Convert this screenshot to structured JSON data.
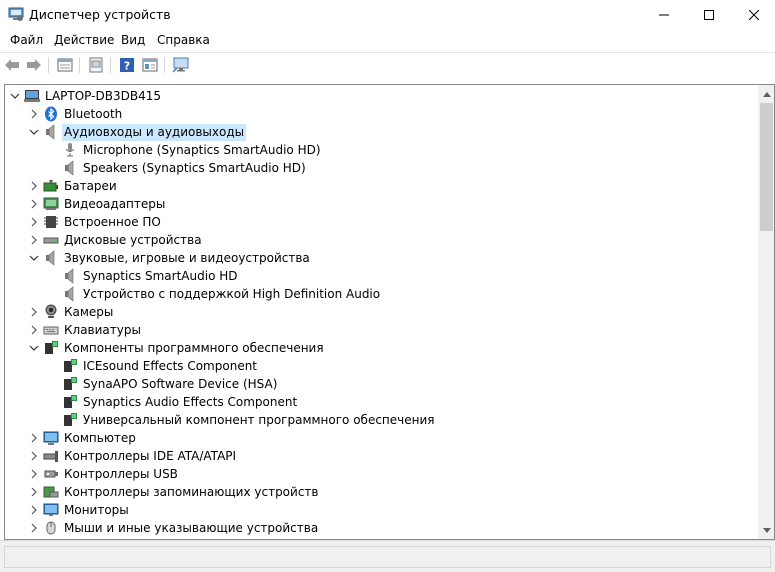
{
  "window": {
    "title": "Диспетчер устройств"
  },
  "menu": [
    "Файл",
    "Действие",
    "Вид",
    "Справка"
  ],
  "toolbar": {
    "buttons": [
      "back-icon",
      "forward-icon",
      "properties-icon",
      "update-driver-icon",
      "help-icon",
      "view-icon",
      "scan-hardware-icon"
    ]
  },
  "tree": {
    "root": "LAPTOP-DB3DB415",
    "items": [
      {
        "label": "Bluetooth",
        "level": 1,
        "state": "collapsed",
        "icon": "bluetooth-icon"
      },
      {
        "label": "Аудиовходы и аудиовыходы",
        "level": 1,
        "state": "expanded",
        "icon": "speaker-icon",
        "selected": true
      },
      {
        "label": "Microphone (Synaptics SmartAudio HD)",
        "level": 2,
        "state": "leaf",
        "icon": "microphone-icon"
      },
      {
        "label": "Speakers (Synaptics SmartAudio HD)",
        "level": 2,
        "state": "leaf",
        "icon": "speaker-icon"
      },
      {
        "label": "Батареи",
        "level": 1,
        "state": "collapsed",
        "icon": "battery-icon"
      },
      {
        "label": "Видеоадаптеры",
        "level": 1,
        "state": "collapsed",
        "icon": "display-adapter-icon"
      },
      {
        "label": "Встроенное ПО",
        "level": 1,
        "state": "collapsed",
        "icon": "firmware-icon"
      },
      {
        "label": "Дисковые устройства",
        "level": 1,
        "state": "collapsed",
        "icon": "disk-drive-icon"
      },
      {
        "label": "Звуковые, игровые и видеоустройства",
        "level": 1,
        "state": "expanded",
        "icon": "speaker-icon"
      },
      {
        "label": "Synaptics SmartAudio HD",
        "level": 2,
        "state": "leaf",
        "icon": "speaker-icon"
      },
      {
        "label": "Устройство с поддержкой High Definition Audio",
        "level": 2,
        "state": "leaf",
        "icon": "speaker-icon"
      },
      {
        "label": "Камеры",
        "level": 1,
        "state": "collapsed",
        "icon": "camera-icon"
      },
      {
        "label": "Клавиатуры",
        "level": 1,
        "state": "collapsed",
        "icon": "keyboard-icon"
      },
      {
        "label": "Компоненты программного обеспечения",
        "level": 1,
        "state": "expanded",
        "icon": "software-component-icon"
      },
      {
        "label": "ICEsound Effects Component",
        "level": 2,
        "state": "leaf",
        "icon": "software-component-icon"
      },
      {
        "label": "SynaAPO Software Device (HSA)",
        "level": 2,
        "state": "leaf",
        "icon": "software-component-icon"
      },
      {
        "label": "Synaptics Audio Effects Component",
        "level": 2,
        "state": "leaf",
        "icon": "software-component-icon"
      },
      {
        "label": "Универсальный компонент программного обеспечения",
        "level": 2,
        "state": "leaf",
        "icon": "software-component-icon"
      },
      {
        "label": "Компьютер",
        "level": 1,
        "state": "collapsed",
        "icon": "computer-icon"
      },
      {
        "label": "Контроллеры IDE ATA/ATAPI",
        "level": 1,
        "state": "collapsed",
        "icon": "ide-controller-icon"
      },
      {
        "label": "Контроллеры USB",
        "level": 1,
        "state": "collapsed",
        "icon": "usb-icon"
      },
      {
        "label": "Контроллеры запоминающих устройств",
        "level": 1,
        "state": "collapsed",
        "icon": "storage-controller-icon"
      },
      {
        "label": "Мониторы",
        "level": 1,
        "state": "collapsed",
        "icon": "monitor-icon"
      },
      {
        "label": "Мыши и иные указывающие устройства",
        "level": 1,
        "state": "collapsed",
        "icon": "mouse-icon"
      }
    ]
  },
  "colors": {
    "selection": "#cce8ff",
    "border": "#828790",
    "statusbar": "#f0f0f0"
  }
}
